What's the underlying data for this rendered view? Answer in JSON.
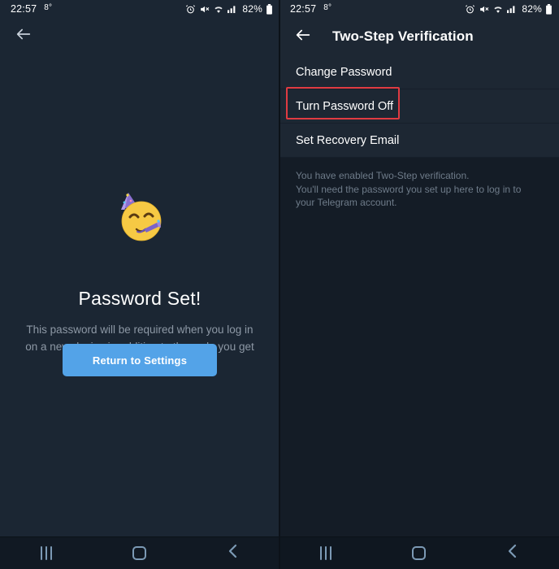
{
  "status_bar": {
    "time": "22:57",
    "temperature": "8°",
    "battery_percent": "82%",
    "icons": [
      "alarm-icon",
      "mute-icon",
      "wifi-icon",
      "signal-icon",
      "battery-icon"
    ]
  },
  "left_panel": {
    "back_icon": "back-arrow-icon",
    "emoji": "partying-face-emoji",
    "title": "Password Set!",
    "description": "This password will be required when you log in on a new device in addition to the code you get in the SMS.",
    "button_label": "Return to Settings",
    "accent_color": "#53a3e8"
  },
  "right_panel": {
    "back_icon": "back-arrow-icon",
    "title": "Two-Step Verification",
    "menu_items": [
      {
        "label": "Change Password",
        "highlighted": false
      },
      {
        "label": "Turn Password Off",
        "highlighted": true
      },
      {
        "label": "Set Recovery Email",
        "highlighted": false
      }
    ],
    "footnote": "You have enabled Two-Step verification.\nYou'll need the password you set up here to log in to your Telegram account.",
    "highlight_color": "#e03b42"
  },
  "nav_bar": {
    "recent_label": "recent-apps-icon",
    "home_label": "home-icon",
    "back_label": "back-icon"
  }
}
